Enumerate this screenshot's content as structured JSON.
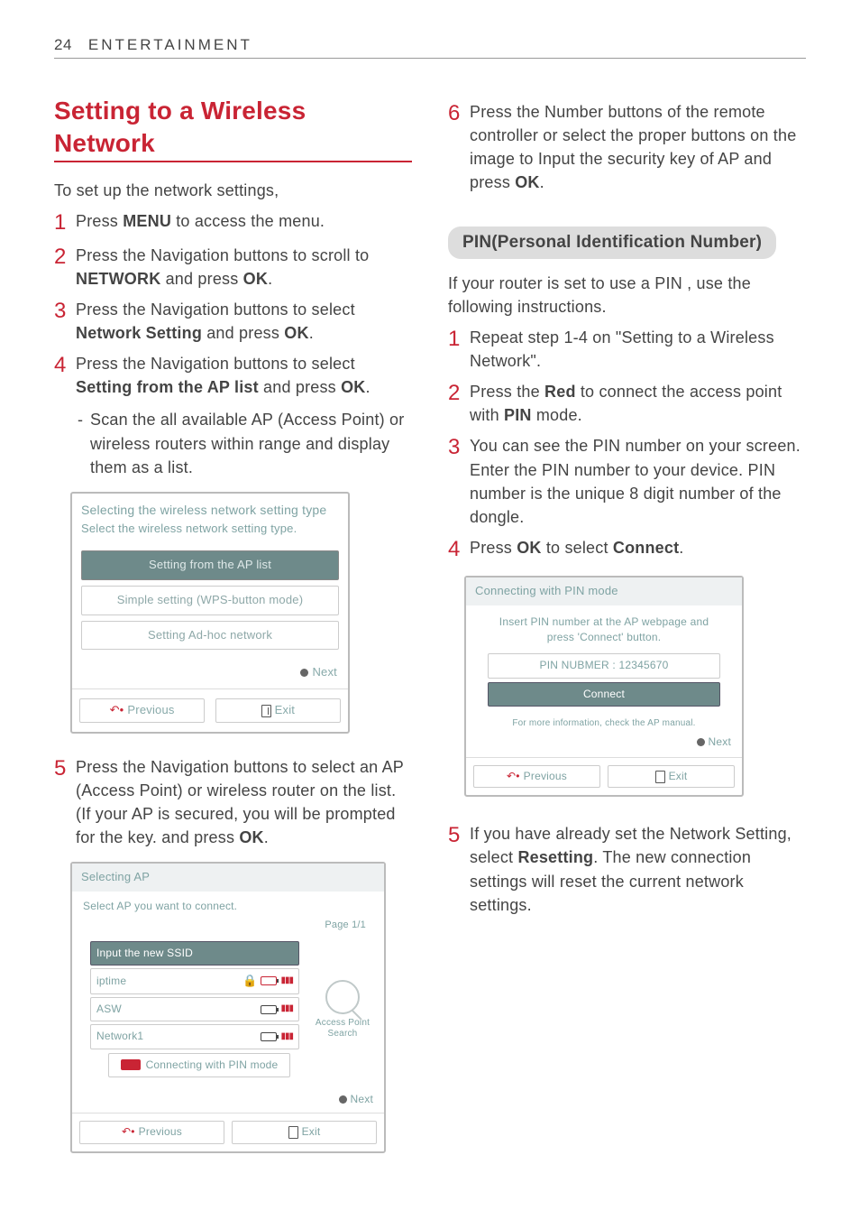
{
  "header": {
    "page_number": "24",
    "section": "ENTERTAINMENT"
  },
  "left": {
    "title": "Setting to a Wireless Network",
    "lead": "To set up the network settings,",
    "step1_a": "Press ",
    "step1_b": "MENU",
    "step1_c": " to access the menu.",
    "step2_a": "Press the Navigation buttons to scroll to ",
    "step2_b": "NETWORK",
    "step2_c": " and press ",
    "step2_d": "OK",
    "step2_e": ".",
    "step3_a": "Press the Navigation buttons to select ",
    "step3_b": "Network Setting",
    "step3_c": " and press ",
    "step3_d": "OK",
    "step3_e": ".",
    "step4_a": "Press the Navigation buttons to select ",
    "step4_b": "Setting from the AP list",
    "step4_c": " and press ",
    "step4_d": "OK",
    "step4_e": ".",
    "step4_sub": "Scan the all available AP (Access Point) or wireless routers within range and display them as a list.",
    "step5": "Press the Navigation buttons to select an AP (Access Point) or wireless router on the list. (If your AP is secured, you will be prompted for the key. and press ",
    "step5_b": "OK"
  },
  "shot1": {
    "title": "Selecting the wireless network setting type",
    "subtitle": "Select the wireless network setting type.",
    "row1": "Setting from the AP list",
    "row2": "Simple setting (WPS-button mode)",
    "row3": "Setting Ad-hoc network",
    "next": "Next",
    "prev": "Previous",
    "exit": "Exit"
  },
  "shot2": {
    "title": "Selecting AP",
    "subtitle": "Select AP you want to connect.",
    "page": "Page 1/1",
    "ssid_row": "Input the new SSID",
    "ap1": "iptime",
    "ap2": "ASW",
    "ap3": "Network1",
    "side": "Access Point Search",
    "pinrow": "Connecting with PIN mode",
    "next": "Next",
    "prev": "Previous",
    "exit": "Exit"
  },
  "right": {
    "step6_a": "Press the Number buttons of the remote controller or select the proper buttons on the image to Input the security key of AP and press ",
    "step6_b": "OK",
    "step6_c": ".",
    "pill": "PIN(Personal Identification Number)",
    "pin_intro": "If your router is set to use a PIN , use the following instructions.",
    "pin1": "Repeat step 1-4 on \"Setting to a Wireless Network\".",
    "pin2_a": "Press the ",
    "pin2_b": "Red",
    "pin2_c": " to connect the access point with ",
    "pin2_d": "PIN",
    "pin2_e": " mode.",
    "pin3": "You can see the PIN number on your screen. Enter the PIN number to your device. PIN number is the unique 8 digit number of the dongle.",
    "pin4_a": "Press ",
    "pin4_b": "OK",
    "pin4_c": " to select ",
    "pin4_d": "Connect",
    "pin4_e": ".",
    "pin5_a": "If you have already set the Network Setting, select ",
    "pin5_b": "Resetting",
    "pin5_c": ". The new connection settings will reset the current network settings."
  },
  "shot3": {
    "title": "Connecting with PIN mode",
    "msg": "Insert PIN number at the AP webpage and press 'Connect' button.",
    "pinrow": "PIN NUBMER : 12345670",
    "connect": "Connect",
    "note": "For more information, check the AP manual.",
    "next": "Next",
    "prev": "Previous",
    "exit": "Exit"
  }
}
